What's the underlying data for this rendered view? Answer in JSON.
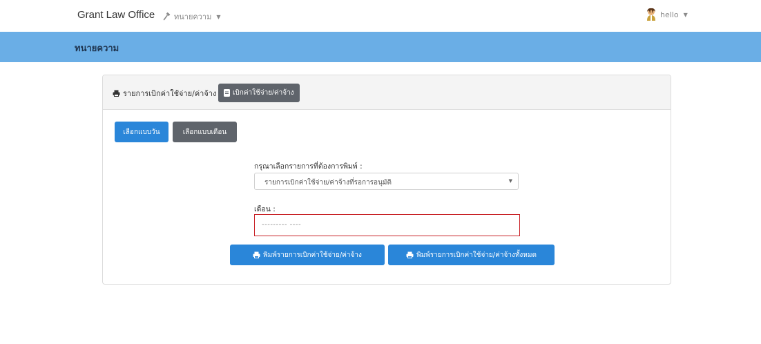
{
  "navbar": {
    "brand": "Grant Law Office",
    "menu_label": "ทนายความ",
    "user_label": "hello"
  },
  "banner": {
    "title": "ทนายความ"
  },
  "card": {
    "header_label": "รายการเบิกค่าใช้จ่าย/ค่าจ้าง",
    "header_button": "เบิกค่าใช้จ่าย/ค่าจ้าง",
    "tab_day": "เลือกแบบวัน",
    "tab_month": "เลือกแบบเดือน",
    "select_label": "กรุณาเลือกรายการที่ต้องการพิมพ์ :",
    "select_value": "รายการเบิกค่าใช้จ่าย/ค่าจ้างที่รอการอนุมัติ",
    "month_label": "เดือน :",
    "month_placeholder": "--------- ----",
    "print_button": "พิมพ์รายการเบิกค่าใช้จ่าย/ค่าจ้าง",
    "print_all_button": "พิมพ์รายการเบิกค่าใช้จ่าย/ค่าจ้างทั้งหมด"
  },
  "colors": {
    "banner": "#6aaee6",
    "primary": "#2a86d9",
    "secondary": "#5f646b",
    "highlight_border": "#c81e23"
  },
  "icons": {
    "menu": "gavel-icon",
    "user": "avatar",
    "header": "print-icon",
    "header_button": "file-icon",
    "print": "print-icon"
  }
}
